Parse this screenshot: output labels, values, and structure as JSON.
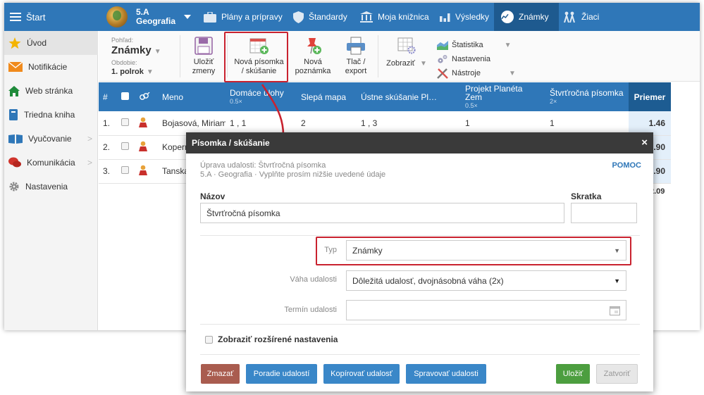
{
  "topbar": {
    "start": "Štart",
    "class_name": "5.A",
    "subject": "Geografia",
    "nav": [
      "Plány a prípravy",
      "Štandardy",
      "Moja knižnica",
      "Výsledky",
      "Známky",
      "Žiaci"
    ]
  },
  "sidebar": {
    "items": [
      {
        "label": "Úvod",
        "icon": "star-icon"
      },
      {
        "label": "Notifikácie",
        "icon": "envelope-icon"
      },
      {
        "label": "Web stránka",
        "icon": "home-icon"
      },
      {
        "label": "Triedna kniha",
        "icon": "book-icon"
      },
      {
        "label": "Vyučovanie",
        "icon": "open-book-icon"
      },
      {
        "label": "Komunikácia",
        "icon": "chat-icon"
      },
      {
        "label": "Nastavenia",
        "icon": "gear-icon"
      }
    ]
  },
  "toolbar": {
    "view_label": "Pohľad:",
    "view_value": "Známky",
    "period_label": "Obdobie:",
    "period_value": "1. polrok",
    "save_line1": "Uložiť",
    "save_line2": "zmeny",
    "new_test_line1": "Nová písomka",
    "new_test_line2": "/ skúšanie",
    "new_note_line1": "Nová",
    "new_note_line2": "poznámka",
    "print_line1": "Tlač /",
    "print_line2": "export",
    "show": "Zobraziť",
    "statistics": "Štatistika",
    "settings": "Nastavenia",
    "tools": "Nástroje"
  },
  "table": {
    "headers": {
      "num": "#",
      "name": "Meno",
      "col1": "Domáce úlohy",
      "col1_sub": "0.5×",
      "col2": "Slepá mapa",
      "col3": "Ústne skúšanie Pl…",
      "col4": "Projekt Planéta Zem",
      "col4_sub": "0.5×",
      "col5": "Štvrťročná písomka",
      "col5_sub": "2×",
      "avg": "Priemer"
    },
    "rows": [
      {
        "num": "1.",
        "name": "Bojasová, Miriam",
        "c1": "1 , 1",
        "c2": "2",
        "c3": "1 , 3",
        "c4": "1",
        "c5": "1",
        "avg": "1.46"
      },
      {
        "num": "2.",
        "name": "Koperni",
        "c1": "",
        "c2": "",
        "c3": "",
        "c4": "",
        "c5": "",
        "avg": "2.90"
      },
      {
        "num": "3.",
        "name": "Tanská,",
        "c1": "",
        "c2": "",
        "c3": "",
        "c4": "",
        "c5": "",
        "avg": "1.90"
      }
    ],
    "total_avg": "2.09"
  },
  "modal": {
    "title": "Písomka / skúšanie",
    "close": "×",
    "subtitle1": "Úprava udalosti: Štvrťročná písomka",
    "subtitle2": "5.A · Geografia · Vyplňte prosím nižšie uvedené údaje",
    "help": "POMOC",
    "name_label": "Názov",
    "name_value": "Štvrťročná písomka",
    "abbr_label": "Skratka",
    "abbr_value": "",
    "type_label": "Typ",
    "type_value": "Známky",
    "weight_label": "Váha udalosti",
    "weight_value": "Dôležitá udalosť, dvojnásobná váha (2x)",
    "date_label": "Termín udalosti",
    "date_value": "",
    "advanced": "Zobraziť rozšírené nastavenia",
    "btn_delete": "Zmazať",
    "btn_order": "Poradie udalostí",
    "btn_copy": "Kopírovať udalosť",
    "btn_manage": "Spravovať udalosti",
    "btn_save": "Uložiť",
    "btn_close": "Zatvoriť"
  },
  "colors": {
    "primary": "#2f77b8",
    "highlight": "#c9222f",
    "save_green": "#4c9e3f",
    "delete_red": "#a95c4f"
  }
}
